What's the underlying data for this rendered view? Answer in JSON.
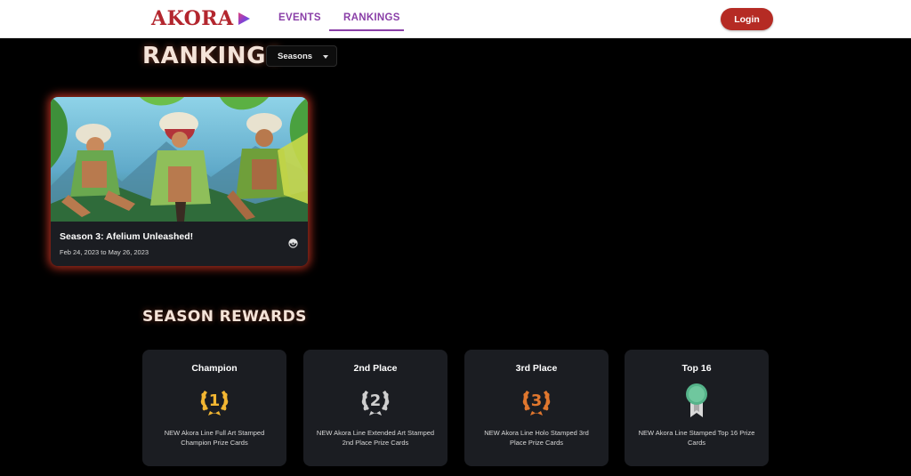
{
  "header": {
    "logo_text": "AKORA",
    "nav": [
      {
        "label": "EVENTS",
        "active": false
      },
      {
        "label": "RANKINGS",
        "active": true
      }
    ],
    "login_label": "Login",
    "accent_color": "#8a3fa8",
    "brand_color": "#b52b24"
  },
  "main": {
    "title": "RANKINGS",
    "season_select": {
      "value": "Seasons"
    },
    "seasons": [
      {
        "title": "Season 3: Afelium Unleashed!",
        "dates": "Feb 24, 2023 to May 26, 2023",
        "icon": "pokeball-icon"
      }
    ],
    "rewards_title": "SEASON REWARDS",
    "rewards": [
      {
        "name": "Champion",
        "badge": "gold-laurel-1-icon",
        "description": "NEW Akora Line Full Art Stamped Champion Prize Cards",
        "color": "#f2b632"
      },
      {
        "name": "2nd Place",
        "badge": "silver-laurel-2-icon",
        "description": "NEW Akora Line Extended Art Stamped 2nd Place Prize Cards",
        "color": "#cfcfcf"
      },
      {
        "name": "3rd Place",
        "badge": "bronze-laurel-3-icon",
        "description": "NEW Akora Line Holo Stamped 3rd Place Prize Cards",
        "color": "#e0772e"
      },
      {
        "name": "Top 16",
        "badge": "ribbon-medal-icon",
        "description": "NEW Akora Line Stamped Top 16 Prize Cards",
        "color": "#55b38a"
      }
    ]
  }
}
